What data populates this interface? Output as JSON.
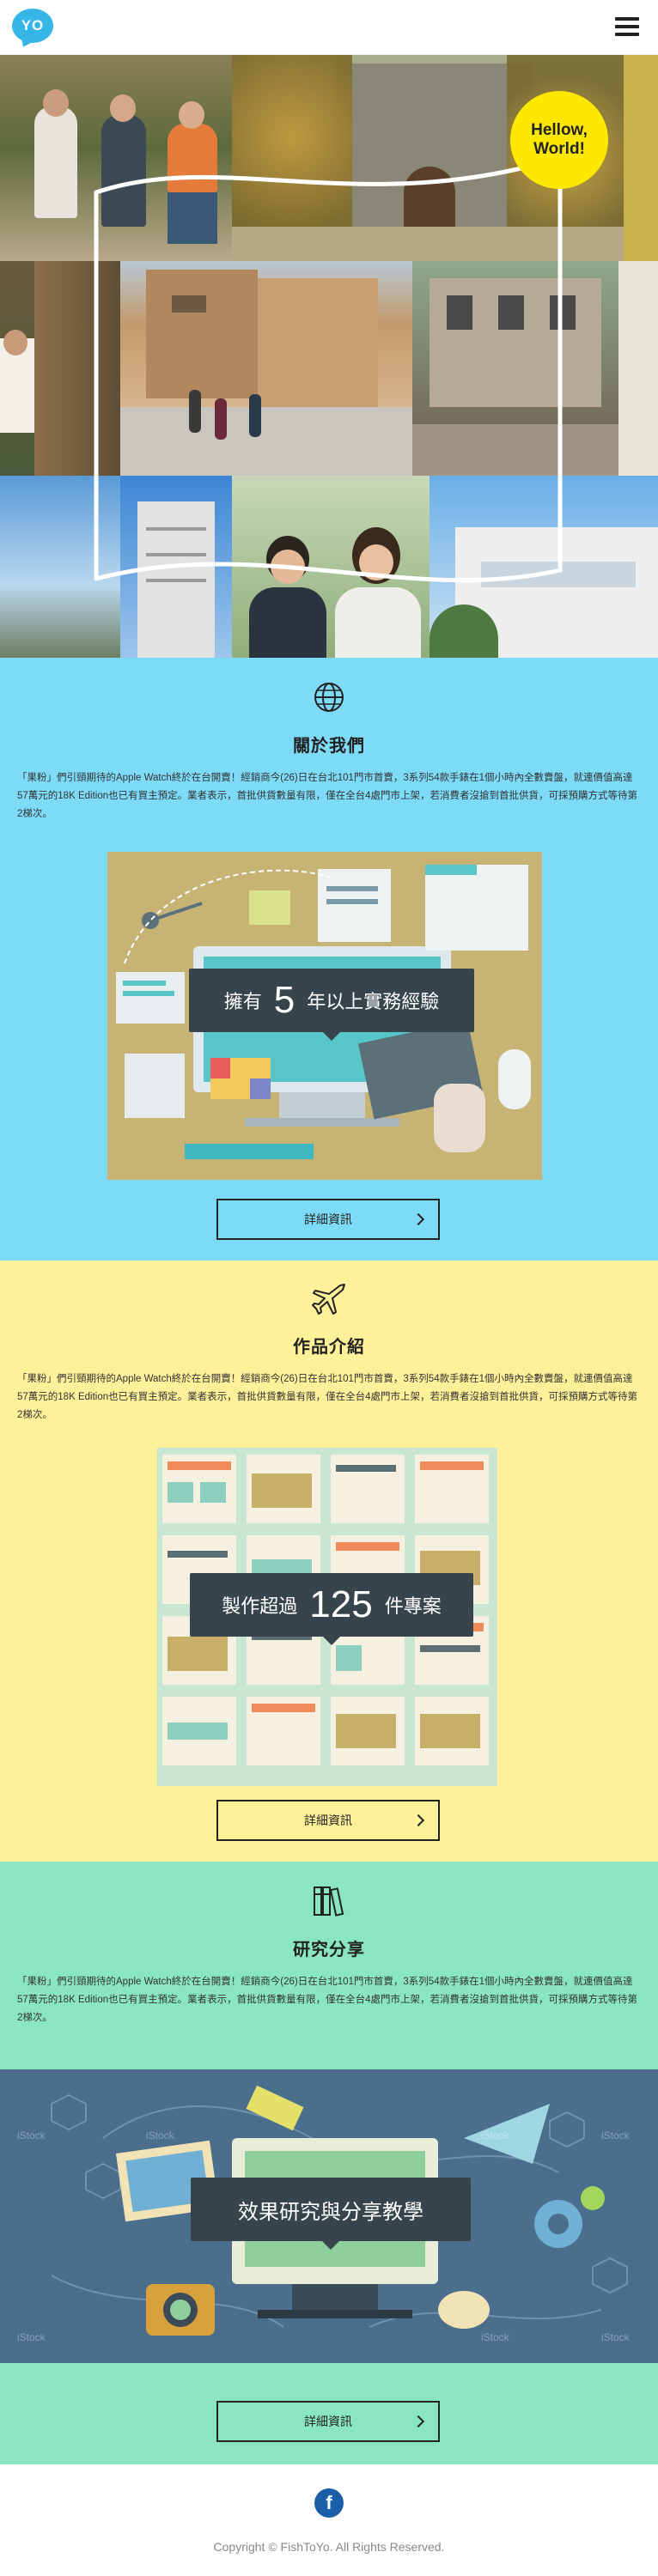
{
  "header": {
    "logo_text": "YO",
    "menu_icon": "hamburger-icon"
  },
  "hero": {
    "bubble_text": "Hellow, World!"
  },
  "about": {
    "icon": "globe-icon",
    "title": "關於我們",
    "text": "「果粉」們引頸期待的Apple Watch終於在台開賣！經銷商今(26)日在台北101門市首賣，3系列54款手錶在1個小時內全數賣盤，就連價值高達57萬元的18K Edition也已有買主預定。業者表示，首批供貨數量有限，僅在全台4處門市上架，若消費者沒搶到首批供貨，可採預購方式等待第2梯次。",
    "overlay_prefix": "擁有",
    "overlay_number": "5",
    "overlay_suffix": "年以上實務經驗",
    "button_label": "詳細資訊",
    "colors": {
      "bg": "#7edbf8"
    }
  },
  "works": {
    "icon": "airplane-icon",
    "title": "作品介紹",
    "text": "「果粉」們引頸期待的Apple Watch終於在台開賣！經銷商今(26)日在台北101門市首賣，3系列54款手錶在1個小時內全數賣盤，就連價值高達57萬元的18K Edition也已有買主預定。業者表示，首批供貨數量有限，僅在全台4處門市上架，若消費者沒搶到首批供貨，可採預購方式等待第2梯次。",
    "overlay_prefix": "製作超過",
    "overlay_number": "125",
    "overlay_suffix": "件專案",
    "button_label": "詳細資訊",
    "colors": {
      "bg": "#fff09a"
    }
  },
  "research": {
    "icon": "books-icon",
    "title": "研究分享",
    "text": "「果粉」們引頸期待的Apple Watch終於在台開賣！經銷商今(26)日在台北101門市首賣，3系列54款手錶在1個小時內全數賣盤，就連價值高達57萬元的18K Edition也已有買主預定。業者表示，首批供貨數量有限，僅在全台4處門市上架，若消費者沒搶到首批供貨，可採預購方式等待第2梯次。",
    "overlay_text": "效果研究與分享教學",
    "watermark": "iStock",
    "button_label": "詳細資訊",
    "colors": {
      "bg": "#8ae6c1"
    }
  },
  "footer": {
    "social_icon": "facebook-icon",
    "social_letter": "f",
    "copyright": "Copyright © FishToYo. All Rights Reserved."
  }
}
